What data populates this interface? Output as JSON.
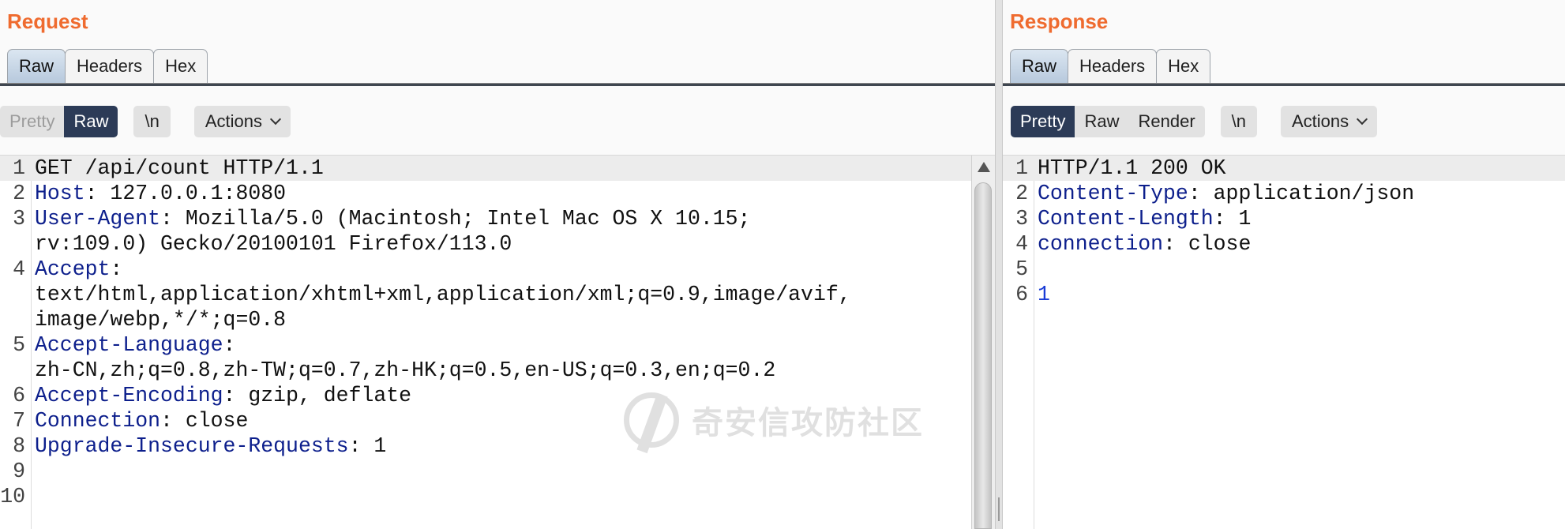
{
  "request": {
    "title": "Request",
    "tabs": [
      {
        "label": "Raw",
        "active": true
      },
      {
        "label": "Headers",
        "active": false
      },
      {
        "label": "Hex",
        "active": false
      }
    ],
    "toolbar": {
      "view_modes": [
        "Pretty",
        "Raw"
      ],
      "selected_view": "Raw",
      "newline_label": "\\n",
      "actions_label": "Actions"
    },
    "lines": [
      {
        "num": "1",
        "name": "",
        "sep": "",
        "value": "GET /api/count HTTP/1.1"
      },
      {
        "num": "2",
        "name": "Host",
        "sep": ":",
        "value": " 127.0.0.1:8080"
      },
      {
        "num": "3",
        "name": "User-Agent",
        "sep": ":",
        "value": " Mozilla/5.0 (Macintosh; Intel Mac OS X 10.15;",
        "cont": "rv:109.0) Gecko/20100101 Firefox/113.0"
      },
      {
        "num": "4",
        "name": "Accept",
        "sep": ":",
        "value": "",
        "cont": "text/html,application/xhtml+xml,application/xml;q=0.9,image/avif,",
        "cont2": "image/webp,*/*;q=0.8"
      },
      {
        "num": "5",
        "name": "Accept-Language",
        "sep": ":",
        "value": "",
        "cont": "zh-CN,zh;q=0.8,zh-TW;q=0.7,zh-HK;q=0.5,en-US;q=0.3,en;q=0.2"
      },
      {
        "num": "6",
        "name": "Accept-Encoding",
        "sep": ":",
        "value": " gzip, deflate"
      },
      {
        "num": "7",
        "name": "Connection",
        "sep": ":",
        "value": " close"
      },
      {
        "num": "8",
        "name": "Upgrade-Insecure-Requests",
        "sep": ":",
        "value": " 1"
      },
      {
        "num": "9",
        "name": "",
        "sep": "",
        "value": ""
      },
      {
        "num": "10",
        "name": "",
        "sep": "",
        "value": ""
      }
    ]
  },
  "response": {
    "title": "Response",
    "tabs": [
      {
        "label": "Raw",
        "active": true
      },
      {
        "label": "Headers",
        "active": false
      },
      {
        "label": "Hex",
        "active": false
      }
    ],
    "toolbar": {
      "view_modes": [
        "Pretty",
        "Raw",
        "Render"
      ],
      "selected_view": "Pretty",
      "newline_label": "\\n",
      "actions_label": "Actions"
    },
    "lines": [
      {
        "num": "1",
        "name": "",
        "sep": "",
        "value": "HTTP/1.1 200 OK"
      },
      {
        "num": "2",
        "name": "Content-Type",
        "sep": ":",
        "value": " application/json"
      },
      {
        "num": "3",
        "name": "Content-Length",
        "sep": ":",
        "value": " 1"
      },
      {
        "num": "4",
        "name": "connection",
        "sep": ":",
        "value": " close"
      },
      {
        "num": "5",
        "name": "",
        "sep": "",
        "value": ""
      },
      {
        "num": "6",
        "name": "",
        "sep": "",
        "value": "1",
        "body": true
      }
    ]
  },
  "watermark": {
    "text": "奇安信攻防社区"
  },
  "colors": {
    "title": "#ef6b2f",
    "header_name": "#0d1f8c",
    "body_value": "#1a3cd6",
    "selected_view": "#2c3b57"
  },
  "icons": {
    "actions": "chevron-down-icon",
    "scroll": "scroll-up-arrow-icon"
  }
}
